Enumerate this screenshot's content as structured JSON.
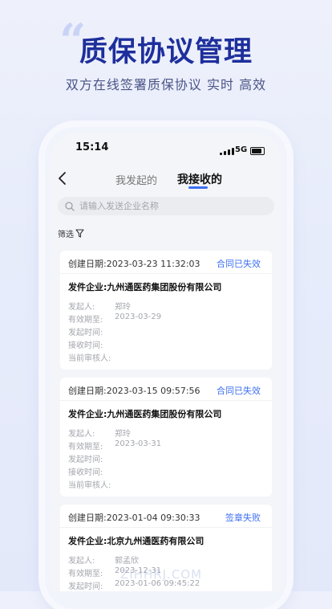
{
  "hero": {
    "title": "质保协议管理",
    "subtitle": "双方在线签署质保协议 实时 高效"
  },
  "status_bar": {
    "time": "15:14",
    "network": "5G"
  },
  "tabs": [
    {
      "label": "我发起的",
      "active": false
    },
    {
      "label": "我接收的",
      "active": true
    }
  ],
  "search": {
    "placeholder": "请输入发送企业名称",
    "value": ""
  },
  "filter": {
    "label": "筛选"
  },
  "labels": {
    "initiator": "发起人:",
    "valid_until": "有效期至:",
    "initiated_time": "发起时间:",
    "received_time": "接收时间:",
    "current_reviewer": "当前审核人:"
  },
  "cards": [
    {
      "created": "创建日期:2023-03-23 11:32:03",
      "status": "合同已失效",
      "company": "发件企业:九州通医药集团股份有限公司",
      "initiator": "郑玲",
      "valid_until": "2023-03-29",
      "initiated_time": "",
      "received_time": "",
      "current_reviewer": ""
    },
    {
      "created": "创建日期:2023-03-15 09:57:56",
      "status": "合同已失效",
      "company": "发件企业:九州通医药集团股份有限公司",
      "initiator": "郑玲",
      "valid_until": "2023-03-31",
      "initiated_time": "",
      "received_time": "",
      "current_reviewer": ""
    },
    {
      "created": "创建日期:2023-01-04 09:30:33",
      "status": "签章失败",
      "company": "发件企业:北京九州通医药有限公司",
      "initiator": "郭孟欣",
      "valid_until": "2023-12-31",
      "initiated_time": "2023-01-06 09:45:22"
    }
  ],
  "watermark": "ZIHHRJ.COM",
  "colors": {
    "accent": "#3c6ff2",
    "hero_title": "#1e2f9c"
  }
}
